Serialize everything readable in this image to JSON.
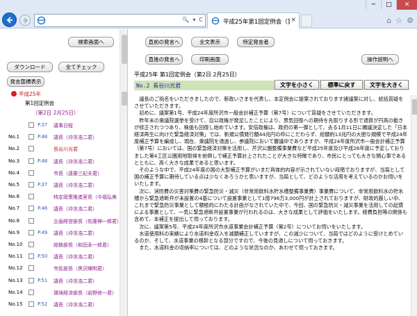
{
  "browser": {
    "tab_title": "平成25年第1回定例会（第...",
    "tab_close": "×",
    "address_ctrl_search": "🔍",
    "address_ctrl_dropdown": "▾",
    "address_ctrl_refresh": "C",
    "window_min": "─",
    "window_max": "□",
    "window_close": "✕",
    "home": "⌂",
    "favorites": "☆",
    "tools": "⚙"
  },
  "left": {
    "search_screen_btn": "検索画面へ",
    "download_btn": "ダウンロード",
    "check_all_btn": "全てチェック",
    "speaker_display_btn": "発言箇標表示",
    "tree": {
      "year": "平成25年",
      "session": "第1回定例会",
      "date": "（第2日 2月25日）"
    },
    "rows": [
      {
        "no": "",
        "page": "P.37",
        "name": "議事日程",
        "red": false
      },
      {
        "no": "No.1",
        "page": "P.48",
        "name": "議長（沖冻浩二君）",
        "red": false
      },
      {
        "no": "No.2",
        "page": "",
        "name": "長谷川光君",
        "red": true
      },
      {
        "no": "No.3",
        "page": "P.48",
        "name": "議長（沖冻浩二君）",
        "red": false
      },
      {
        "no": "No.4",
        "page": "",
        "name": "市長（遠藤三紀夫君）",
        "red": false
      },
      {
        "no": "No.5",
        "page": "P.37",
        "name": "議長（沖冻浩二君）",
        "red": false
      },
      {
        "no": "No.6",
        "page": "",
        "name": "特定政策推進室長（今福弘美",
        "red": false
      },
      {
        "no": "No.7",
        "page": "P.48",
        "name": "議長（沖冻浩二君）",
        "red": false
      },
      {
        "no": "No.8",
        "page": "",
        "name": "企画経営部長（佐藤伸一郎君）",
        "red": false
      },
      {
        "no": "No.9",
        "page": "P.49",
        "name": "議長（沖冻浩二君）",
        "red": false
      },
      {
        "no": "No.10",
        "page": "",
        "name": "総務部長（和田永一郎君）",
        "red": false
      },
      {
        "no": "No.11",
        "page": "P.50",
        "name": "議長（沖冻浩二君）",
        "red": false
      },
      {
        "no": "No.12",
        "page": "",
        "name": "市民部長（黒沢輝明君）",
        "red": false
      },
      {
        "no": "No.13",
        "page": "P.51",
        "name": "議長（沖冻浩二君）",
        "red": false
      },
      {
        "no": "No.14",
        "page": "",
        "name": "環境経済部長（岩野修一君）",
        "red": false
      },
      {
        "no": "No.15",
        "page": "P.52",
        "name": "議長（沖冻浩二君）",
        "red": false
      }
    ]
  },
  "right": {
    "prev_speech_btn": "直前の発言へ",
    "full_display_btn": "全文表示",
    "specified_speaker_btn": "特定発言者",
    "next_speech_btn": "直後の発言へ",
    "print_screen_btn": "印刷画面",
    "operation_btn": "操作説明へ",
    "meeting_title": "平成25年 第1回定例会（第2日 2月25日）",
    "speaker_label": "No.2 長谷川光君",
    "smaller_btn": "文字を小さく",
    "standard_btn": "標準に戻す",
    "larger_btn": "文字を大きく",
    "paragraphs": [
      "議長のご指名をいただきましたので、新政いさまを代表し、本定例会に提案されております諸議案に対し、総括質疑をさせていただきます。",
      "初めに、議案第1号、平成24年度所沢市一般会計補正予算（第7号）について質疑をさせていただきます。",
      "昨年末の衆議院選挙を受けて、自公政権が発足したことにより、景気回復への期待を先取りする形で通貨が円高の動きが修正されつつあり、株価も回復し始めています。安倍政権は、政府の第一弾として、去る1月11日に閣議決定した「日本経済再生に向けた緊急経済対策」では、新規公債発行額44兆円の枠にこだわらず、総額約13兆円の大胆な規模で平成24年度補正予算を編成し、現在、衆議院を通過し、参議院において審議中でありますが、平成24年度所沢市一般会計補正予算（第7号）においては、国の緊急経済対策を活用し、芹沢公園整備事業費など平成25年度及び平成26年度に予定しておりました第4工区公園用地取得を前倒しで補正予算計上されたことが大きな特徴であり、市民にとっても大きな関心事であるとともに、高く大きな成果であると思います。",
      "そのような中で、平成24年度の国の大型補正予算がいまだ具体的内容が示されていない段階でおりますが、当局として国の補正予算に期待している点は少なくあろうかと思いますが、当局として、どのような活用を考えているのかお伺いをいたします。",
      "次に、消防費の災害対策費の緊急防災・減災（非常用飲料水貯水槽整備事業費）事業費について、非常用飲料水の貯水槽から緊急遮断弁が未設置の4基について設置事業として1億796万3,000円が計上されておりますが、財政的厳しい中、これまで緊急防災事業として積極的にわたる計画がなされていた中で、今回、国の緊急防災・減災事業を活用しての起債による事業として、一気に緊急遮断弁設置事業が行われるのは、大きな成果として評価をいたします。経費負担等の関係も含めて、本補正を提出して伺っております。",
      "次に、議案第5号、平成24年度所沢市水道事業会計補正予算（第2号）についてお伺いをいたします。",
      "水道使用料の実績により水道料金収入を減額補正していますが、この減少について、当局ではどのように受けとめているのか、そして、水道事業の根幹となる部分ですので、今後の見通しについて伺っておきます。",
      "また、水道料金の収納率については、どのような状況なのか、あわせて伺っておきます。"
    ]
  }
}
